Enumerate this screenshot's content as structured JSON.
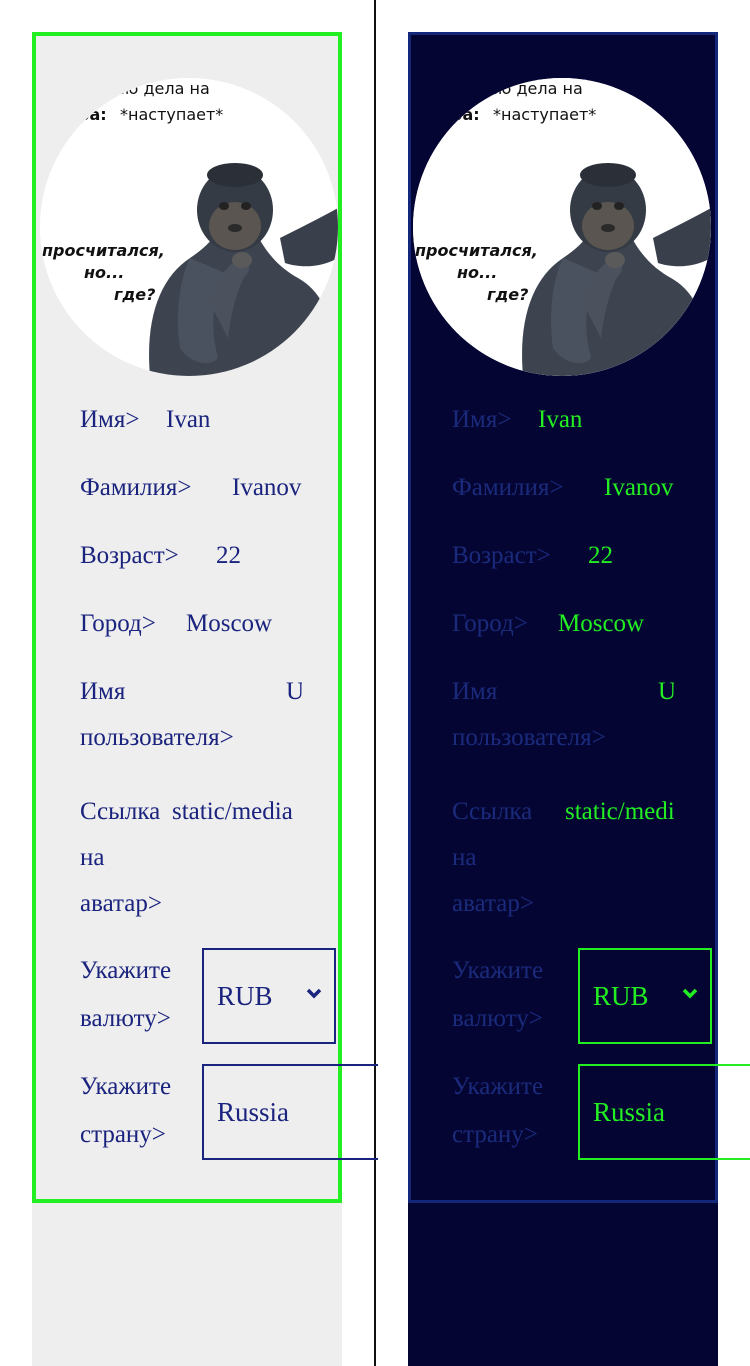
{
  "profile": {
    "avatar_meme": {
      "top_text_1": "дываю дела на",
      "top_text_2_bold": "ра:",
      "top_text_2": "*наступает*",
      "bottom_text_1": "просчитался,",
      "bottom_text_2": "но...",
      "bottom_text_3": "где?"
    },
    "name_label": "Имя>",
    "name_value": "Ivan",
    "surname_label": "Фамилия>",
    "surname_value": "Ivanov",
    "age_label": "Возраст>",
    "age_value": "22",
    "city_label": "Город>",
    "city_value": "Moscow",
    "username_label_1": "Имя",
    "username_label_2": "пользователя>",
    "username_value": "U",
    "avatar_link_label_1": "Ссылка",
    "avatar_link_label_2": "на",
    "avatar_link_label_3": "аватар>",
    "avatar_link_value": "static/media",
    "currency_label_1": "Укажите",
    "currency_label_2": "валюту>",
    "currency_value": "RUB",
    "country_label_1": "Укажите",
    "country_label_2": "страну>",
    "country_value": "Russia"
  },
  "colors": {
    "light_bg": "#eeeeee",
    "dark_bg": "#050534",
    "accent_green": "#22ee22",
    "navy_text": "#1a237e"
  }
}
